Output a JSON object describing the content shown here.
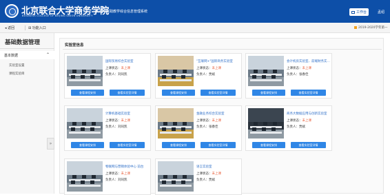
{
  "header": {
    "brand_title": "北京联合大学商务学院",
    "brand_subtitle": "BUSINESS COLLEGE OF BEIJING UNION UNIVERSITY",
    "system_name": "实验与实践教学综合信息管理系统",
    "workbench_label": "工作台",
    "user_label": "孟绍"
  },
  "subbar": {
    "back_label": "◂ 返回",
    "home_label": "⊞ 功能入口",
    "semester": "2019-2020学年第一"
  },
  "sidebar": {
    "title": "基础数据管理",
    "group_label": "基本数据",
    "items": [
      "实验室设置",
      "课程实验目"
    ]
  },
  "main": {
    "title": "实验室信息"
  },
  "labels": {
    "status_prefix": "上课状态：",
    "manager_prefix": "负责人：",
    "btn_schedule": "查看课程安排",
    "btn_detail": "查看实验室详情"
  },
  "labs": [
    {
      "name": "国际贸易综合实验室",
      "status": "未上课",
      "manager": "刘同凯"
    },
    {
      "name": "\"互联网+\"国际商务实验室",
      "status": "未上课",
      "manager": "贾斌"
    },
    {
      "name": "会计机房实验室、前端财务实验室",
      "status": "未上课",
      "manager": "张春佳"
    },
    {
      "name": "计算机基础实验室",
      "status": "未上课",
      "manager": "刘同凯"
    },
    {
      "name": "金融业务综合实验室",
      "status": "未上课",
      "manager": "张春佳"
    },
    {
      "name": "商务大数据应用与创新实验室",
      "status": "未上课",
      "manager": "贾斌"
    },
    {
      "name": "物联网与营销体验中心 前台",
      "status": "未上课",
      "manager": "刘同凯"
    },
    {
      "name": "语言实验室",
      "status": "未上课",
      "manager": "贾斌"
    }
  ]
}
